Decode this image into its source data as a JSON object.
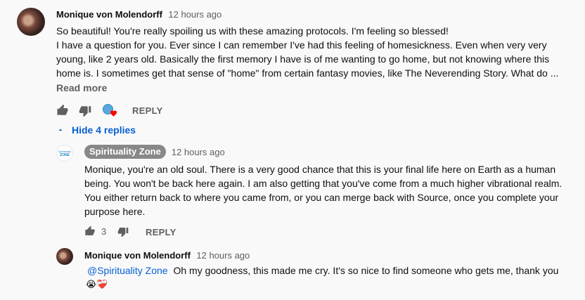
{
  "comment": {
    "author": "Monique von Molendorff",
    "time": "12 hours ago",
    "lines": [
      "So beautiful! You're really spoiling us with these amazing protocols. I'm feeling so blessed!",
      "I have a question for you. Ever since I can remember I've had this feeling of homesickness. Even when very very",
      "young, like 2 years old. Basically the first memory I have is of me wanting to go home, but not knowing where this",
      "home is. I sometimes get that sense of \"home\" from certain fantasy movies, like The Neverending Story. What do ..."
    ],
    "read_more": "Read more",
    "reply_label": "REPLY",
    "hide_replies": "Hide 4 replies"
  },
  "reply1": {
    "author": "Spirituality Zone",
    "avatar_text_top": "Spirituality",
    "avatar_text_bottom": "ZONE",
    "time": "12 hours ago",
    "lines": [
      "Monique, you're an old soul. There is a very good chance that this is your final life here on Earth as a human",
      "being. You won't be back here again. I am also getting that you've come from a much higher vibrational realm.",
      "You either return back to where you came from, or you can merge back with Source, once you complete your",
      "purpose here."
    ],
    "like_count": "3",
    "reply_label": "REPLY"
  },
  "reply2": {
    "author": "Monique von Molendorff",
    "time": "12 hours ago",
    "mention": "@Spirituality Zone",
    "text": "Oh my goodness, this made me cry. It's so nice to find someone who gets me, thank you",
    "emoji": "😭❤️‍🩹"
  },
  "icons": {
    "like": "thumbs-up-icon",
    "dislike": "thumbs-down-icon",
    "creator_heart": "creator-heart-icon",
    "chevron": "chevron-up-icon"
  },
  "colors": {
    "link_blue": "#065fd4",
    "meta_gray": "#606060",
    "chip_gray": "#888888",
    "heart_red": "#ff0000"
  }
}
